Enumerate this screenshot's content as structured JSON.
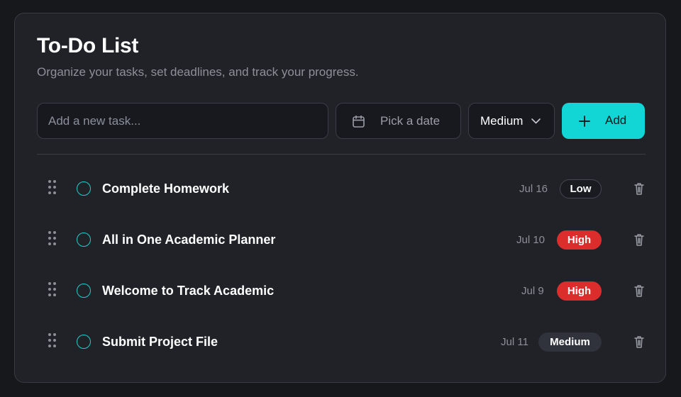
{
  "header": {
    "title": "To-Do List",
    "subtitle": "Organize your tasks, set deadlines, and track your progress."
  },
  "new_task": {
    "input_placeholder": "Add a new task...",
    "date_placeholder": "Pick a date",
    "priority_value": "Medium",
    "add_label": "Add"
  },
  "icons": {
    "calendar": "calendar-icon",
    "chevron": "chevron-down-icon",
    "add": "plus-icon",
    "drag": "drag-handle-icon",
    "complete": "circle-checkbox-icon",
    "delete": "trash-icon"
  },
  "colors": {
    "accent": "#12d6d6",
    "high": "#dc2d2d",
    "medium": "#30333c",
    "low": "#191b20"
  },
  "tasks": [
    {
      "title": "Complete Homework",
      "date": "Jul 16",
      "priority": "Low",
      "priority_level": "low"
    },
    {
      "title": "All in One Academic Planner",
      "date": "Jul 10",
      "priority": "High",
      "priority_level": "high"
    },
    {
      "title": "Welcome to Track Academic",
      "date": "Jul 9",
      "priority": "High",
      "priority_level": "high"
    },
    {
      "title": "Submit Project File",
      "date": "Jul 11",
      "priority": "Medium",
      "priority_level": "medium"
    }
  ]
}
